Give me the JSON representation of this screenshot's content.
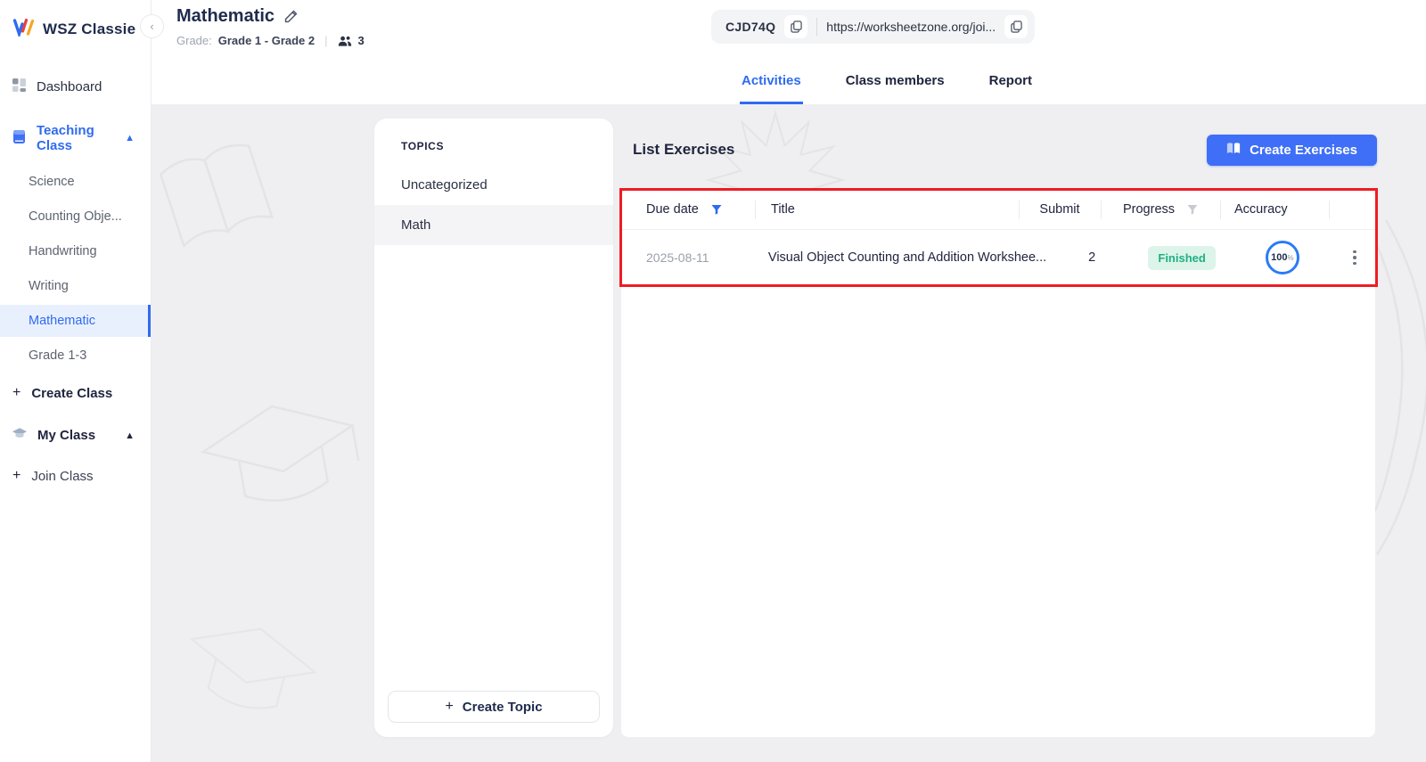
{
  "brand": {
    "name": "WSZ Classie"
  },
  "sidebar": {
    "dashboard": "Dashboard",
    "teaching_class": "Teaching Class",
    "classes": [
      "Science",
      "Counting Obje...",
      "Handwriting",
      "Writing",
      "Mathematic",
      "Grade 1-3"
    ],
    "selected_class": "Mathematic",
    "create_class": "Create Class",
    "my_class": "My Class",
    "join_class": "Join Class"
  },
  "header": {
    "title": "Mathematic",
    "grade_label": "Grade:",
    "grade_value": "Grade 1 - Grade 2",
    "member_count": "3",
    "class_code": "CJD74Q",
    "class_url": "https://worksheetzone.org/joi..."
  },
  "tabs": [
    {
      "label": "Activities",
      "active": true
    },
    {
      "label": "Class members",
      "active": false
    },
    {
      "label": "Report",
      "active": false
    }
  ],
  "topics": {
    "heading": "TOPICS",
    "items": [
      "Uncategorized",
      "Math"
    ],
    "selected": "Math",
    "create_button": "Create Topic"
  },
  "exercises": {
    "heading": "List Exercises",
    "create_button": "Create Exercises",
    "table": {
      "columns": [
        "Due date",
        "Title",
        "Submit",
        "Progress",
        "Accuracy"
      ],
      "rows": [
        {
          "due_date": "2025-08-11",
          "title": "Visual Object Counting and Addition Workshee...",
          "submit": "2",
          "progress": "Finished",
          "accuracy": "100",
          "accuracy_unit": "%"
        }
      ]
    }
  },
  "colors": {
    "accent_blue": "#2f6bf0",
    "button_blue": "#3f6ff7",
    "selected_item_bg": "#e9f0fd",
    "finished_badge_bg": "#dcf4ea",
    "finished_badge_text": "#1fb083",
    "accuracy_ring": "#2a7bf6",
    "highlight_border": "#ee1d23",
    "content_bg": "#efeff1"
  }
}
